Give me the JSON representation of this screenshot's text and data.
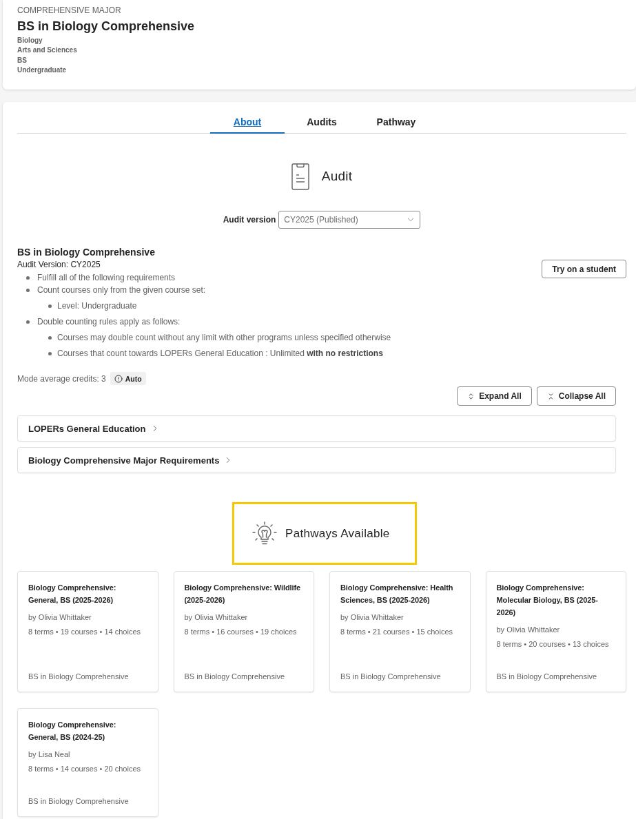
{
  "header": {
    "eyebrow": "COMPREHENSIVE MAJOR",
    "title": "BS in Biology Comprehensive",
    "details": [
      "Biology",
      "Arts and Sciences",
      "BS",
      "Undergraduate"
    ]
  },
  "tabs": [
    {
      "label": "About",
      "selected": true
    },
    {
      "label": "Audits",
      "selected": false
    },
    {
      "label": "Pathway",
      "selected": false
    }
  ],
  "audit": {
    "heading": "Audit",
    "version_label": "Audit version",
    "version_value": "CY2025 (Published)",
    "title": "BS in Biology Comprehensive",
    "version_line": "Audit Version: CY2025",
    "try_button": "Try on a student",
    "rules": [
      {
        "text": "Fulfill all of the following requirements"
      },
      {
        "text": "Count courses only from the given course set:",
        "children": [
          {
            "text": "Level: Undergraduate"
          }
        ]
      },
      {
        "text": "Double counting rules apply as follows:",
        "children": [
          {
            "text": "Courses may double count without any limit with other programs unless specified otherwise"
          },
          {
            "text": "Courses that count towards LOPERs General Education : Unlimited **with no restrictions**"
          }
        ]
      }
    ],
    "mode_credits": "Mode average credits: 3",
    "mode_badge": "Auto",
    "expand_button": "Expand All",
    "collapse_button": "Collapse All",
    "sections": [
      {
        "title": "LOPERs General Education",
        "expanded": false
      },
      {
        "title": "Biology Comprehensive Major Requirements",
        "expanded": false
      }
    ]
  },
  "pathways": {
    "heading": "Pathways Available",
    "highlighted": true,
    "cards": [
      {
        "title": "Biology Comprehensive: General, BS (2025-2026)",
        "author": "by Olivia Whittaker",
        "stats": "8 terms • 19 courses • 14 choices",
        "program": "BS in Biology Comprehensive"
      },
      {
        "title": "Biology Comprehensive: Wildlife (2025-2026)",
        "author": "by Olivia Whittaker",
        "stats": "8 terms • 16 courses • 19 choices",
        "program": "BS in Biology Comprehensive"
      },
      {
        "title": "Biology Comprehensive: Health Sciences, BS (2025-2026)",
        "author": "by Olivia Whittaker",
        "stats": "8 terms • 21 courses • 15 choices",
        "program": "BS in Biology Comprehensive"
      },
      {
        "title": "Biology Comprehensive: Molecular Biology, BS (2025-2026)",
        "author": "by Olivia Whittaker",
        "stats": "8 terms • 20 courses • 13 choices",
        "program": "BS in Biology Comprehensive"
      },
      {
        "title": "Biology Comprehensive: General, BS (2024-25)",
        "author": "by Lisa Neal",
        "stats": "8 terms • 14 courses • 20 choices",
        "program": "BS in Biology Comprehensive"
      }
    ]
  }
}
